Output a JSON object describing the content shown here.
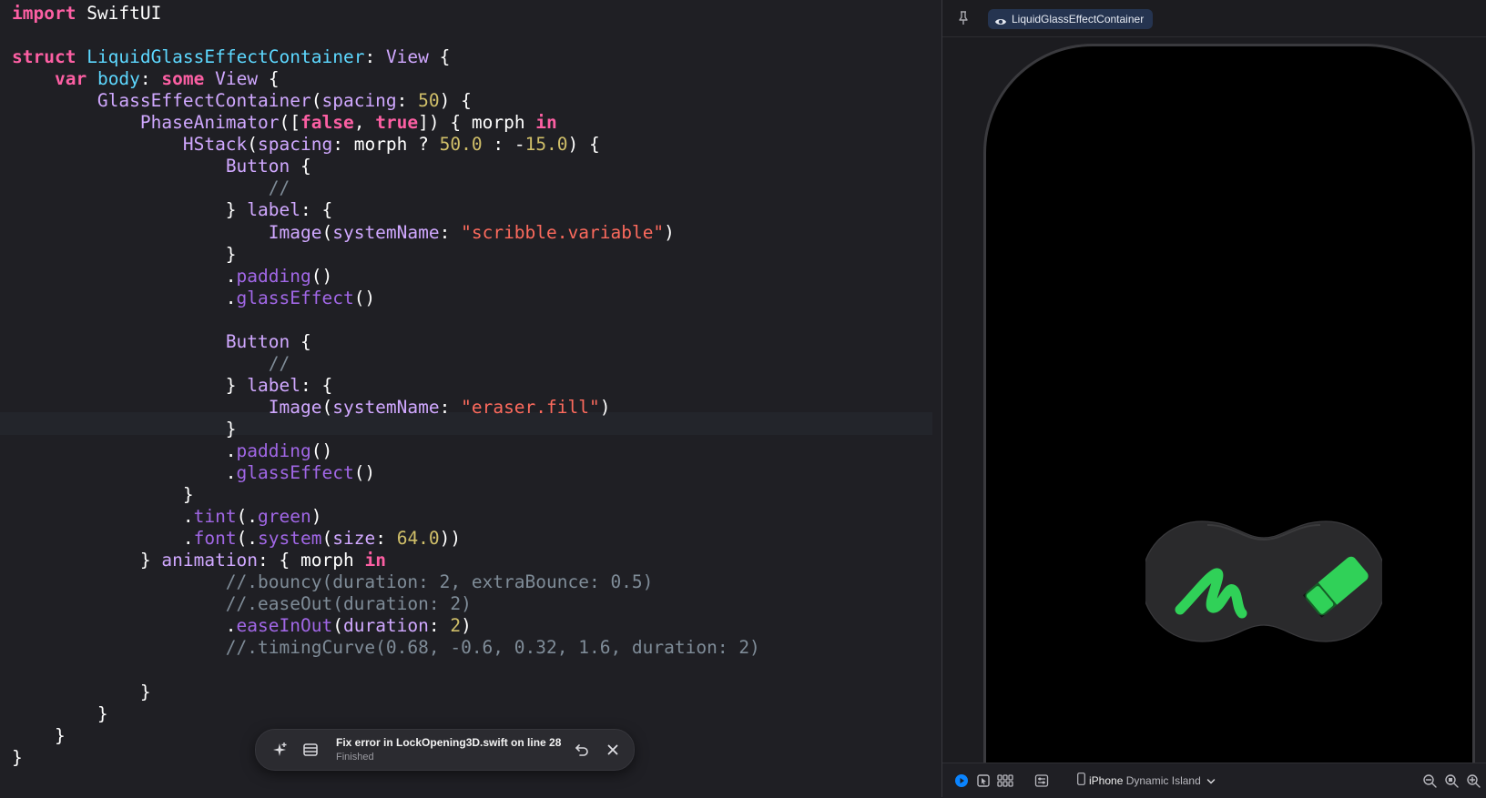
{
  "editor": {
    "highlighted_line": 19,
    "lines": [
      [
        [
          "kw",
          "import"
        ],
        [
          "pl",
          " SwiftUI"
        ]
      ],
      [],
      [
        [
          "kw",
          "struct"
        ],
        [
          "pl",
          " "
        ],
        [
          "ty",
          "LiquidGlassEffectContainer"
        ],
        [
          "pl",
          ": "
        ],
        [
          "pr",
          "View"
        ],
        [
          "pl",
          " {"
        ]
      ],
      [
        [
          "pl",
          "    "
        ],
        [
          "kw",
          "var"
        ],
        [
          "pl",
          " "
        ],
        [
          "ty",
          "body"
        ],
        [
          "pl",
          ": "
        ],
        [
          "kw",
          "some"
        ],
        [
          "pl",
          " "
        ],
        [
          "pr",
          "View"
        ],
        [
          "pl",
          " {"
        ]
      ],
      [
        [
          "pl",
          "        "
        ],
        [
          "pr",
          "GlassEffectContainer"
        ],
        [
          "pl",
          "("
        ],
        [
          "pr",
          "spacing"
        ],
        [
          "pl",
          ": "
        ],
        [
          "num",
          "50"
        ],
        [
          "pl",
          ") {"
        ]
      ],
      [
        [
          "pl",
          "            "
        ],
        [
          "pr",
          "PhaseAnimator"
        ],
        [
          "pl",
          "(["
        ],
        [
          "kw",
          "false"
        ],
        [
          "pl",
          ", "
        ],
        [
          "kw",
          "true"
        ],
        [
          "pl",
          "]) { morph "
        ],
        [
          "kw",
          "in"
        ]
      ],
      [
        [
          "pl",
          "                "
        ],
        [
          "pr",
          "HStack"
        ],
        [
          "pl",
          "("
        ],
        [
          "pr",
          "spacing"
        ],
        [
          "pl",
          ": morph ? "
        ],
        [
          "num",
          "50.0"
        ],
        [
          "pl",
          " : -"
        ],
        [
          "num",
          "15.0"
        ],
        [
          "pl",
          ") {"
        ]
      ],
      [
        [
          "pl",
          "                    "
        ],
        [
          "pr",
          "Button"
        ],
        [
          "pl",
          " {"
        ]
      ],
      [
        [
          "cm",
          "                        //"
        ]
      ],
      [
        [
          "pl",
          "                    } "
        ],
        [
          "pr",
          "label"
        ],
        [
          "pl",
          ": {"
        ]
      ],
      [
        [
          "pl",
          "                        "
        ],
        [
          "pr",
          "Image"
        ],
        [
          "pl",
          "("
        ],
        [
          "pr",
          "systemName"
        ],
        [
          "pl",
          ": "
        ],
        [
          "str",
          "\"scribble.variable\""
        ],
        [
          "pl",
          ")"
        ]
      ],
      [
        [
          "pl",
          "                    }"
        ]
      ],
      [
        [
          "pl",
          "                    ."
        ],
        [
          "fn",
          "padding"
        ],
        [
          "pl",
          "()"
        ]
      ],
      [
        [
          "pl",
          "                    ."
        ],
        [
          "fn",
          "glassEffect"
        ],
        [
          "pl",
          "()"
        ]
      ],
      [],
      [
        [
          "pl",
          "                    "
        ],
        [
          "pr",
          "Button"
        ],
        [
          "pl",
          " {"
        ]
      ],
      [
        [
          "cm",
          "                        //"
        ]
      ],
      [
        [
          "pl",
          "                    } "
        ],
        [
          "pr",
          "label"
        ],
        [
          "pl",
          ": {"
        ]
      ],
      [
        [
          "pl",
          "                        "
        ],
        [
          "pr",
          "Image"
        ],
        [
          "pl",
          "("
        ],
        [
          "pr",
          "systemName"
        ],
        [
          "pl",
          ": "
        ],
        [
          "str",
          "\"eraser.fill\""
        ],
        [
          "pl",
          ")"
        ]
      ],
      [
        [
          "pl",
          "                    }"
        ]
      ],
      [
        [
          "pl",
          "                    ."
        ],
        [
          "fn",
          "padding"
        ],
        [
          "pl",
          "()"
        ]
      ],
      [
        [
          "pl",
          "                    ."
        ],
        [
          "fn",
          "glassEffect"
        ],
        [
          "pl",
          "()"
        ]
      ],
      [
        [
          "pl",
          "                }"
        ]
      ],
      [
        [
          "pl",
          "                ."
        ],
        [
          "fn",
          "tint"
        ],
        [
          "pl",
          "(."
        ],
        [
          "fn",
          "green"
        ],
        [
          "pl",
          ")"
        ]
      ],
      [
        [
          "pl",
          "                ."
        ],
        [
          "fn",
          "font"
        ],
        [
          "pl",
          "(."
        ],
        [
          "fn",
          "system"
        ],
        [
          "pl",
          "("
        ],
        [
          "pr",
          "size"
        ],
        [
          "pl",
          ": "
        ],
        [
          "num",
          "64.0"
        ],
        [
          "pl",
          "))"
        ]
      ],
      [
        [
          "pl",
          "            } "
        ],
        [
          "pr",
          "animation"
        ],
        [
          "pl",
          ": { morph "
        ],
        [
          "kw",
          "in"
        ]
      ],
      [
        [
          "cm",
          "                    //.bouncy(duration: 2, extraBounce: 0.5)"
        ]
      ],
      [
        [
          "cm",
          "                    //.easeOut(duration: 2)"
        ]
      ],
      [
        [
          "pl",
          "                    ."
        ],
        [
          "fn",
          "easeInOut"
        ],
        [
          "pl",
          "("
        ],
        [
          "pr",
          "duration"
        ],
        [
          "pl",
          ": "
        ],
        [
          "num",
          "2"
        ],
        [
          "pl",
          ")"
        ]
      ],
      [
        [
          "cm",
          "                    //.timingCurve(0.68, -0.6, 0.32, 1.6, duration: 2)"
        ]
      ],
      [],
      [
        [
          "pl",
          "            }"
        ]
      ],
      [
        [
          "pl",
          "        }"
        ]
      ],
      [
        [
          "pl",
          "    }"
        ]
      ],
      [
        [
          "pl",
          "}"
        ]
      ]
    ]
  },
  "toast": {
    "title": "Fix error in LockOpening3D.swift on line 28",
    "status": "Finished",
    "icons": [
      "sparkle-plus-icon",
      "stack-icon",
      "undo-icon",
      "close-icon"
    ]
  },
  "preview": {
    "chip_label": "LiquidGlassEffectContainer",
    "glass_icons": [
      "scribble.variable",
      "eraser.fill"
    ],
    "tint_color": "#30d158",
    "device_name": "iPhone",
    "device_model": "Dynamic Island",
    "toolbar_icons": [
      "live-mode-icon",
      "selectable-mode-icon",
      "variants-grid-icon",
      "canvas-settings-icon",
      "iphone-icon",
      "zoom-out-icon",
      "zoom-fit-icon",
      "zoom-in-icon"
    ]
  }
}
